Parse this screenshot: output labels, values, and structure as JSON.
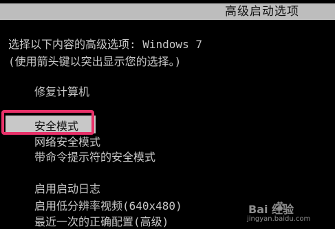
{
  "header": {
    "title": "高级启动选项"
  },
  "instructions": {
    "line1": "选择以下内容的高级选项: Windows 7",
    "line2": "(使用箭头键以突出显示您的选择。)"
  },
  "options": {
    "repair": "修复计算机",
    "safe_mode": "安全模式",
    "safe_mode_networking": "网络安全模式",
    "safe_mode_cmd": "带命令提示符的安全模式",
    "boot_logging": "启用启动日志",
    "low_res_video": "启用低分辨率视频(640x480)",
    "last_known_good": "最近一次的正确配置(高级)"
  },
  "selected_option": "safe_mode",
  "watermark": {
    "logo_text": "Bai  经验",
    "url": "jingyan.baidu.com"
  },
  "colors": {
    "background": "#000000",
    "text": "#c8c8c8",
    "header_bar": "#bdbdbd",
    "selection_bar": "#c8c8c8",
    "highlight_border": "#e8326a"
  }
}
